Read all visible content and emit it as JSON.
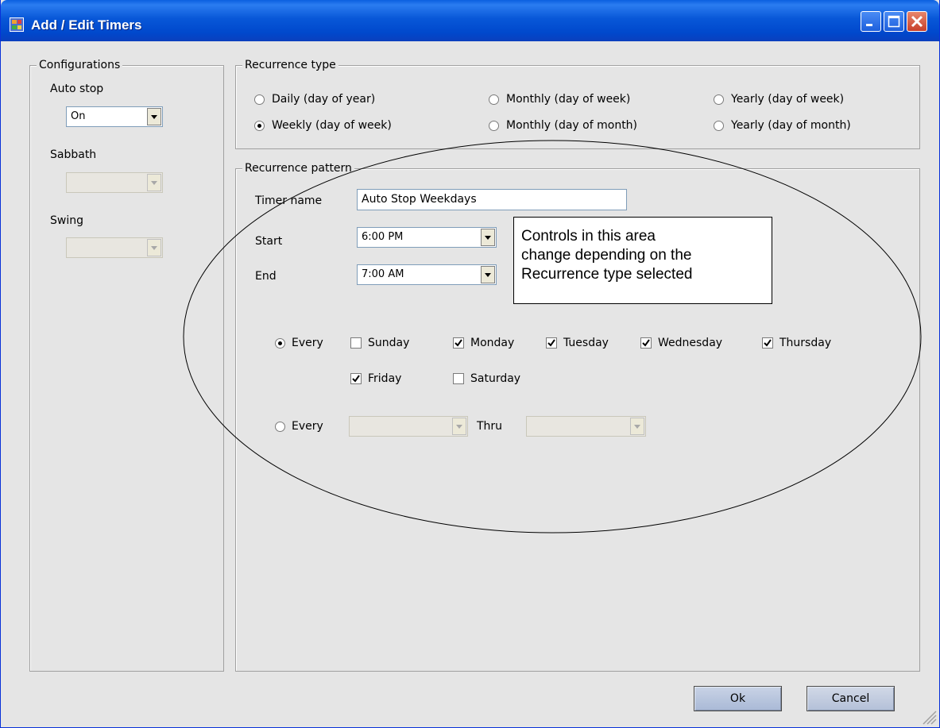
{
  "window": {
    "title": "Add / Edit Timers"
  },
  "configurations": {
    "title": "Configurations",
    "auto_stop": {
      "label": "Auto stop",
      "value": "On"
    },
    "sabbath": {
      "label": "Sabbath",
      "value": ""
    },
    "swing": {
      "label": "Swing",
      "value": ""
    }
  },
  "recurrence_type": {
    "title": "Recurrence type",
    "options": [
      "Daily (day of year)",
      "Weekly (day of week)",
      "Monthly (day of week)",
      "Monthly (day of month)",
      "Yearly (day of week)",
      "Yearly (day of month)"
    ],
    "selected": "Weekly (day of week)"
  },
  "recurrence_pattern": {
    "title": "Recurrence pattern",
    "timer_name": {
      "label": "Timer name",
      "value": "Auto Stop Weekdays"
    },
    "start": {
      "label": "Start",
      "value": "6:00 PM"
    },
    "end": {
      "label": "End",
      "value": "7:00 AM"
    },
    "every_days": {
      "label": "Every",
      "selected": true,
      "days": [
        {
          "name": "Sunday",
          "checked": false
        },
        {
          "name": "Monday",
          "checked": true
        },
        {
          "name": "Tuesday",
          "checked": true
        },
        {
          "name": "Wednesday",
          "checked": true
        },
        {
          "name": "Thursday",
          "checked": true
        },
        {
          "name": "Friday",
          "checked": true
        },
        {
          "name": "Saturday",
          "checked": false
        }
      ]
    },
    "every_range": {
      "label": "Every",
      "thru_label": "Thru",
      "from_value": "",
      "thru_value": ""
    }
  },
  "callout": {
    "lines": [
      "Controls in this area",
      "change depending on the",
      "Recurrence type selected"
    ]
  },
  "buttons": {
    "ok": "Ok",
    "cancel": "Cancel"
  }
}
